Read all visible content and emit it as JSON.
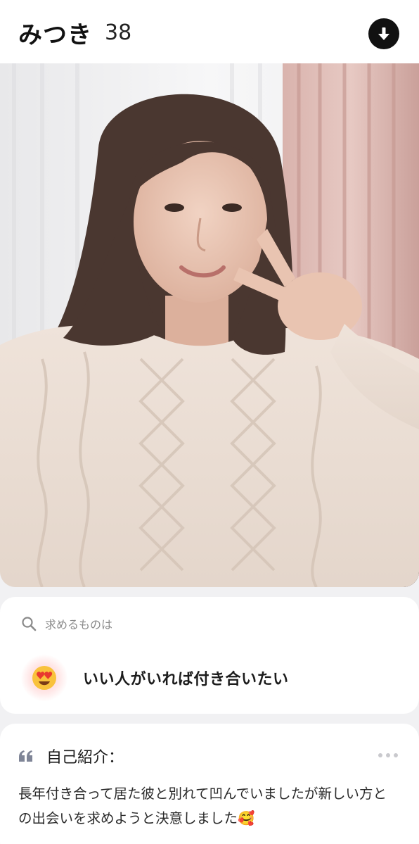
{
  "profile": {
    "name": "みつき",
    "age": "38"
  },
  "header": {
    "download_icon": "download-arrow-icon"
  },
  "photo": {
    "description_icon": "profile-photo"
  },
  "looking_for": {
    "label": "求めるものは",
    "icon": "search-icon",
    "emoji": "😍",
    "value": "いい人がいれば付き合いたい"
  },
  "intro": {
    "title": "自己紹介：",
    "quote_icon": "quote-icon",
    "body": "長年付き合って居た彼と別れて凹んでいましたが新しい方との出会いを求めようと決意しました🥰"
  },
  "colors": {
    "background": "#f1f1f3",
    "card": "#ffffff",
    "accent_dark": "#111111",
    "label_gray": "#8a8a8a"
  }
}
